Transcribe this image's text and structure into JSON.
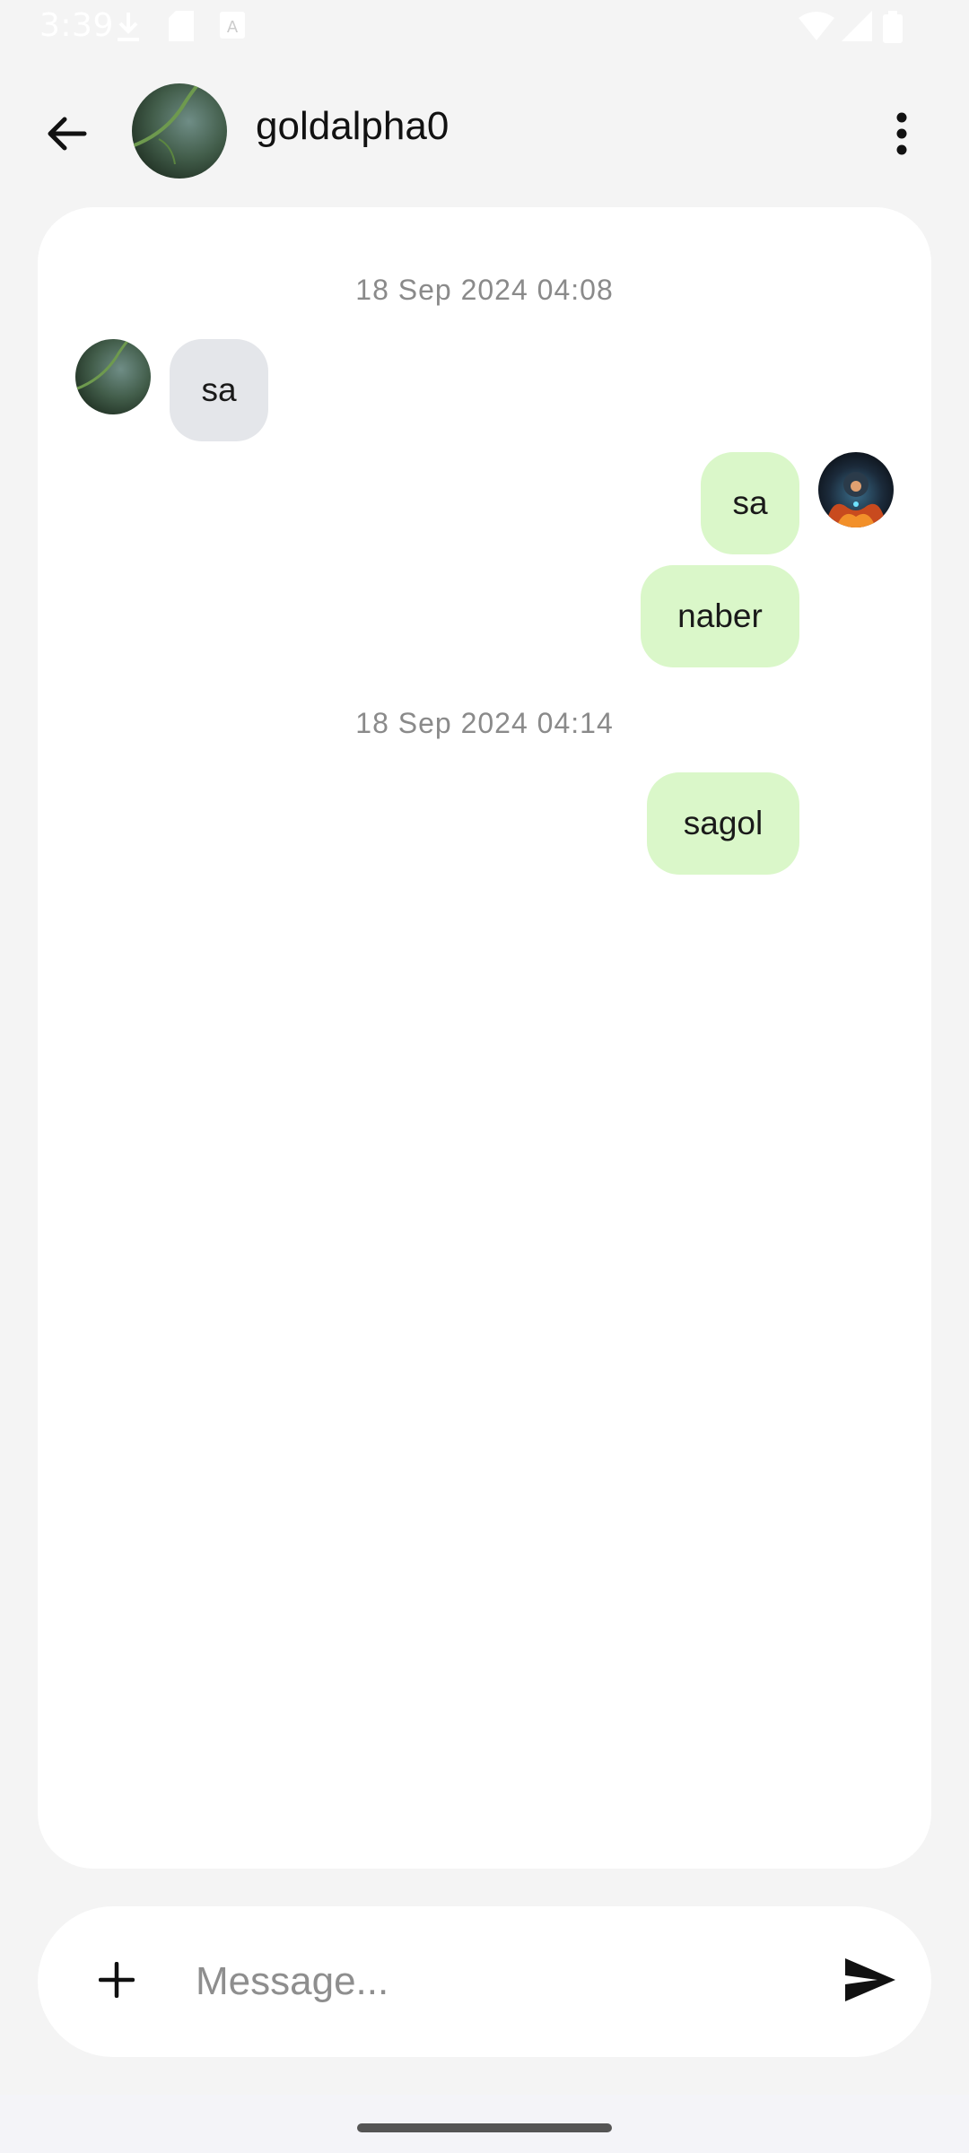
{
  "status_bar": {
    "time": "3:39",
    "icons": [
      "download-icon",
      "sd-card-icon",
      "keyboard-a-icon",
      "wifi-icon",
      "signal-icon",
      "battery-icon"
    ]
  },
  "header": {
    "contact_name": "goldalpha0",
    "back_icon": "arrow-left-icon",
    "menu_icon": "more-vert-icon"
  },
  "conversation": {
    "date_separators": [
      "18 Sep 2024 04:08",
      "18 Sep 2024 04:14"
    ],
    "messages": [
      {
        "direction": "incoming",
        "text": "sa"
      },
      {
        "direction": "outgoing",
        "text": "sa"
      },
      {
        "direction": "outgoing",
        "text": "naber"
      },
      {
        "direction": "outgoing",
        "text": "sagol"
      }
    ]
  },
  "composer": {
    "placeholder": "Message...",
    "value": "",
    "attach_icon": "plus-icon",
    "send_icon": "send-icon"
  },
  "colors": {
    "background": "#f4f4f4",
    "card": "#ffffff",
    "incoming_bubble": "#e4e6ea",
    "outgoing_bubble": "#daf7c9",
    "timestamp": "#8a8a8a"
  }
}
